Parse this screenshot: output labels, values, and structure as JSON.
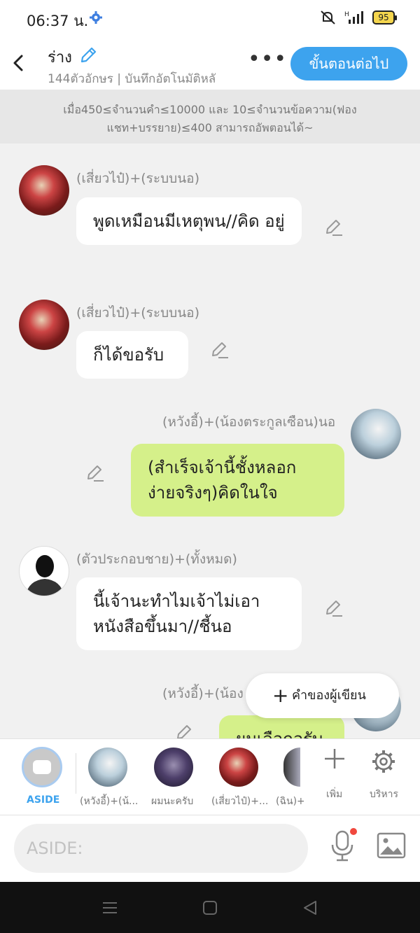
{
  "status": {
    "time": "06:37 น.",
    "battery": "95",
    "signal_label": "H"
  },
  "header": {
    "title": "ร่าง",
    "subtitle": "144ตัวอักษร | บันทึกอัตโนมัติหลั",
    "more": "•••",
    "next_button": "ขั้นตอนต่อไป"
  },
  "notice": {
    "text": "เมื่อ450≤จำนวนคำ≤10000 และ 10≤จำนวนข้อความ(ฟอง แชท+บรรยาย)≤400 สามารถอัพตอนได้~"
  },
  "messages": [
    {
      "speaker": "(เสี่ยวไป๋)+(ระบบนอ)",
      "text": "พูดเหมือนมีเหตุพน//คิด อยู่",
      "side": "left",
      "avatar": "red"
    },
    {
      "speaker": "(เสี่ยวไป๋)+(ระบบนอ)",
      "text": "ก็ได้ขอรับ",
      "side": "left",
      "avatar": "red"
    },
    {
      "speaker": "(หวังอี้)+(น้องตระกูลเซือน)นอ",
      "text": "(สำเร็จเจ้านี้ชั้งหลอก ง่ายจริงๆ)คิดในใจ",
      "side": "right",
      "avatar": "silver"
    },
    {
      "speaker": "(ตัวประกอบชาย)+(ทั้งหมด)",
      "text": "นี้เจ้านะทำไมเจ้าไม่เอา หนังสือขึ้นมา//ชี้นอ",
      "side": "left",
      "avatar": "shadow"
    },
    {
      "speaker": "(หวังอี้)+(น้อง",
      "text": "ผมเลือกอรับ",
      "side": "right",
      "avatar": "silver"
    }
  ],
  "fab": {
    "label": "คำของผู้เขียน"
  },
  "characters": {
    "aside_label": "ASIDE",
    "items": [
      {
        "name": "(หวังอี้)+(น้...",
        "avatar": "silver"
      },
      {
        "name": "ผมนะครับ",
        "avatar": "dark"
      },
      {
        "name": "(เสี่ยวไป๋)+...",
        "avatar": "red"
      },
      {
        "name": "(ฉิน)+",
        "avatar": "silver"
      }
    ],
    "add_label": "เพิ่ม",
    "manage_label": "บริหาร"
  },
  "input": {
    "placeholder": "ASIDE:"
  },
  "colors": {
    "accent": "#3da3ee",
    "green_bubble": "#d5f08a",
    "notice_bg": "#e7e7e7"
  }
}
